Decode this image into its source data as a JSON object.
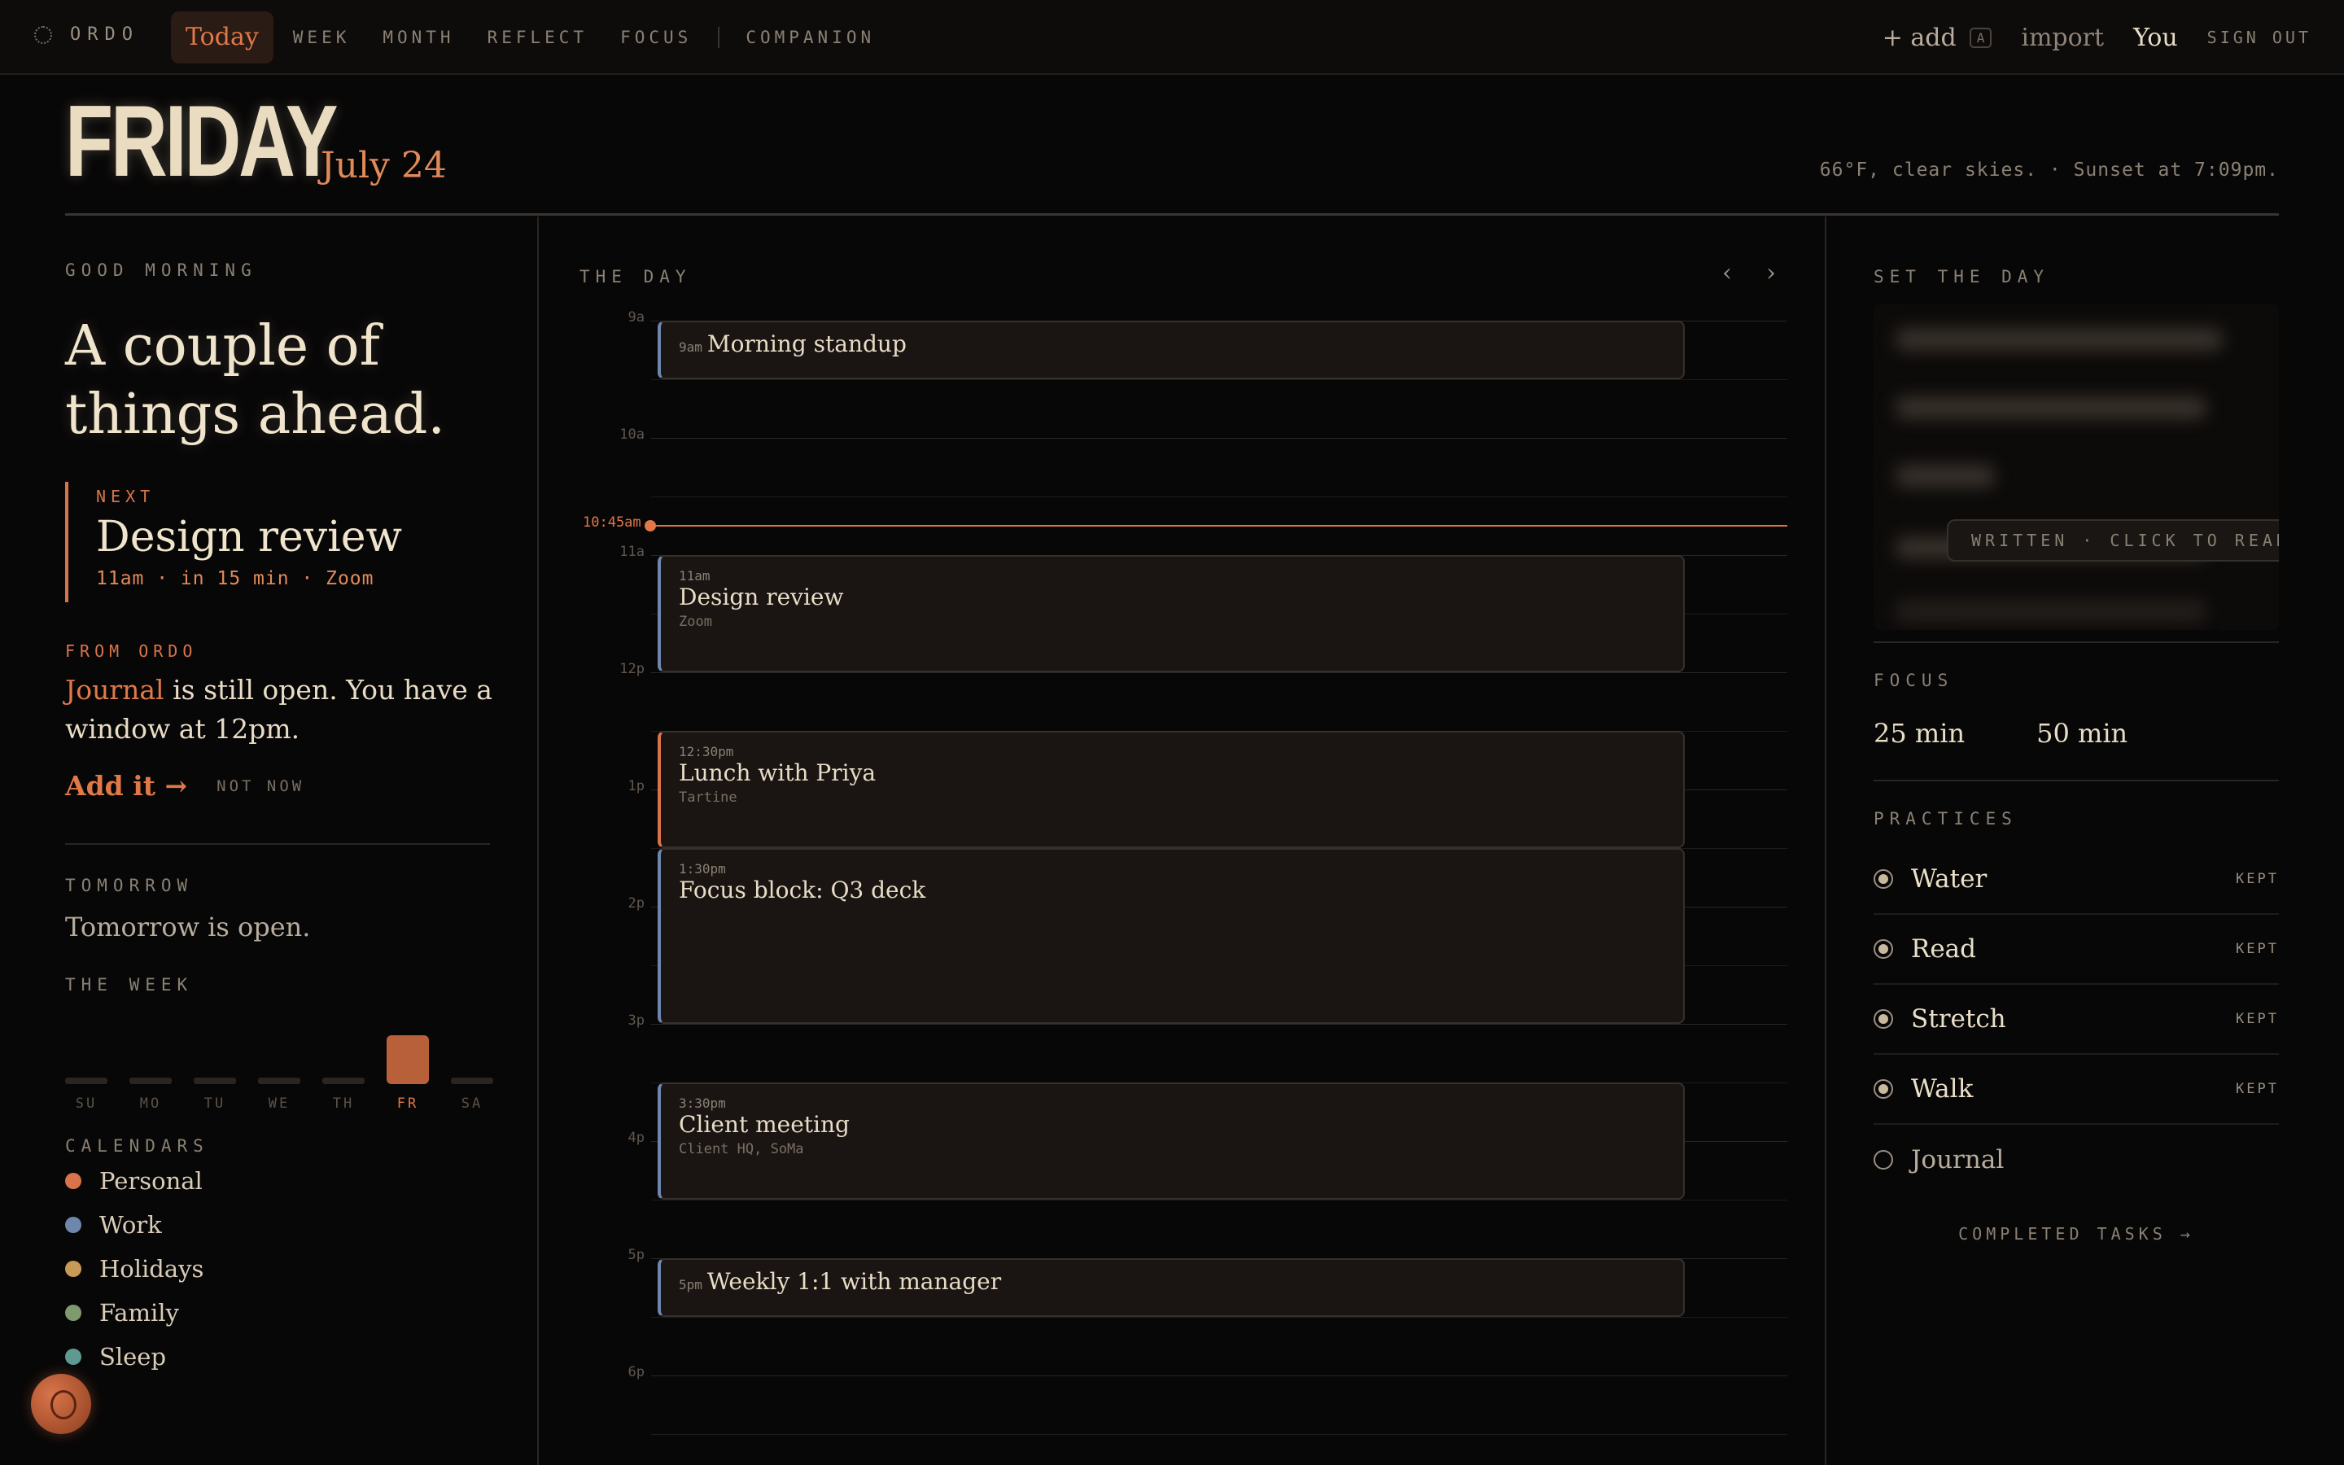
{
  "brand": {
    "name": "ORDO",
    "icon": "dotted-circle-icon"
  },
  "nav": [
    {
      "label": "Today",
      "active": true
    },
    {
      "label": "WEEK"
    },
    {
      "label": "MONTH"
    },
    {
      "label": "REFLECT"
    },
    {
      "label": "FOCUS"
    },
    {
      "label": "COMPANION"
    }
  ],
  "topbar": {
    "add_label": "+ add",
    "add_shortcut": "A",
    "import_label": "import",
    "user_label": "You",
    "signout_label": "SIGN OUT"
  },
  "header": {
    "day": "FRIDAY",
    "date": "July 24",
    "weather": "66°F, clear skies. · Sunset at 7:09pm."
  },
  "left": {
    "greeting": "GOOD MORNING",
    "headline": "A couple of things ahead.",
    "next": {
      "kicker": "NEXT",
      "title": "Design review",
      "meta": "11am · in 15 min · Zoom"
    },
    "from_ordo": {
      "kicker": "FROM ORDO",
      "highlight": "Journal",
      "text": " is still open. You have a window at 12pm.",
      "primary": "Add it →",
      "secondary": "NOT NOW"
    },
    "tomorrow": {
      "kicker": "TOMORROW",
      "text": "Tomorrow is open."
    },
    "week": {
      "kicker": "THE WEEK",
      "days": [
        {
          "label": "SU",
          "active": false
        },
        {
          "label": "MO",
          "active": false
        },
        {
          "label": "TU",
          "active": false
        },
        {
          "label": "WE",
          "active": false
        },
        {
          "label": "TH",
          "active": false
        },
        {
          "label": "FR",
          "active": true
        },
        {
          "label": "SA",
          "active": false
        }
      ]
    },
    "calendars": {
      "kicker": "CALENDARS",
      "items": [
        {
          "label": "Personal",
          "color": "#d9744a"
        },
        {
          "label": "Work",
          "color": "#6f86ad"
        },
        {
          "label": "Holidays",
          "color": "#c89a55"
        },
        {
          "label": "Family",
          "color": "#7f9a6e"
        },
        {
          "label": "Sleep",
          "color": "#5f9a90"
        }
      ]
    }
  },
  "day": {
    "kicker": "THE DAY",
    "prev_icon": "chevron-left-icon",
    "next_icon": "chevron-right-icon",
    "hours": [
      "9a",
      "10a",
      "11a",
      "12p",
      "1p",
      "2p",
      "3p",
      "4p",
      "5p",
      "6p"
    ],
    "now_label": "10:45am",
    "events": [
      {
        "time": "9am",
        "title": "Morning standup",
        "location": ""
      },
      {
        "time": "11am",
        "title": "Design review",
        "location": "Zoom"
      },
      {
        "time": "12:30pm",
        "title": "Lunch with Priya",
        "location": "Tartine"
      },
      {
        "time": "1:30pm",
        "title": "Focus block: Q3 deck",
        "location": ""
      },
      {
        "time": "3:30pm",
        "title": "Client meeting",
        "location": "Client HQ, SoMa"
      },
      {
        "time": "5pm",
        "title": "Weekly 1:1 with manager",
        "location": ""
      }
    ]
  },
  "right": {
    "set_the_day": {
      "kicker": "SET THE DAY",
      "overlay": "WRITTEN · CLICK TO READ"
    },
    "focus": {
      "kicker": "FOCUS",
      "options": [
        "25 min",
        "50 min"
      ]
    },
    "practices": {
      "kicker": "PRACTICES",
      "items": [
        {
          "label": "Water",
          "status": "KEPT",
          "done": true
        },
        {
          "label": "Read",
          "status": "KEPT",
          "done": true
        },
        {
          "label": "Stretch",
          "status": "KEPT",
          "done": true
        },
        {
          "label": "Walk",
          "status": "KEPT",
          "done": true
        },
        {
          "label": "Journal",
          "status": "",
          "done": false
        }
      ]
    },
    "completed_link": "COMPLETED TASKS →"
  },
  "colors": {
    "accent": "#d9744a",
    "work": "#6f86ad",
    "background": "#080707"
  }
}
